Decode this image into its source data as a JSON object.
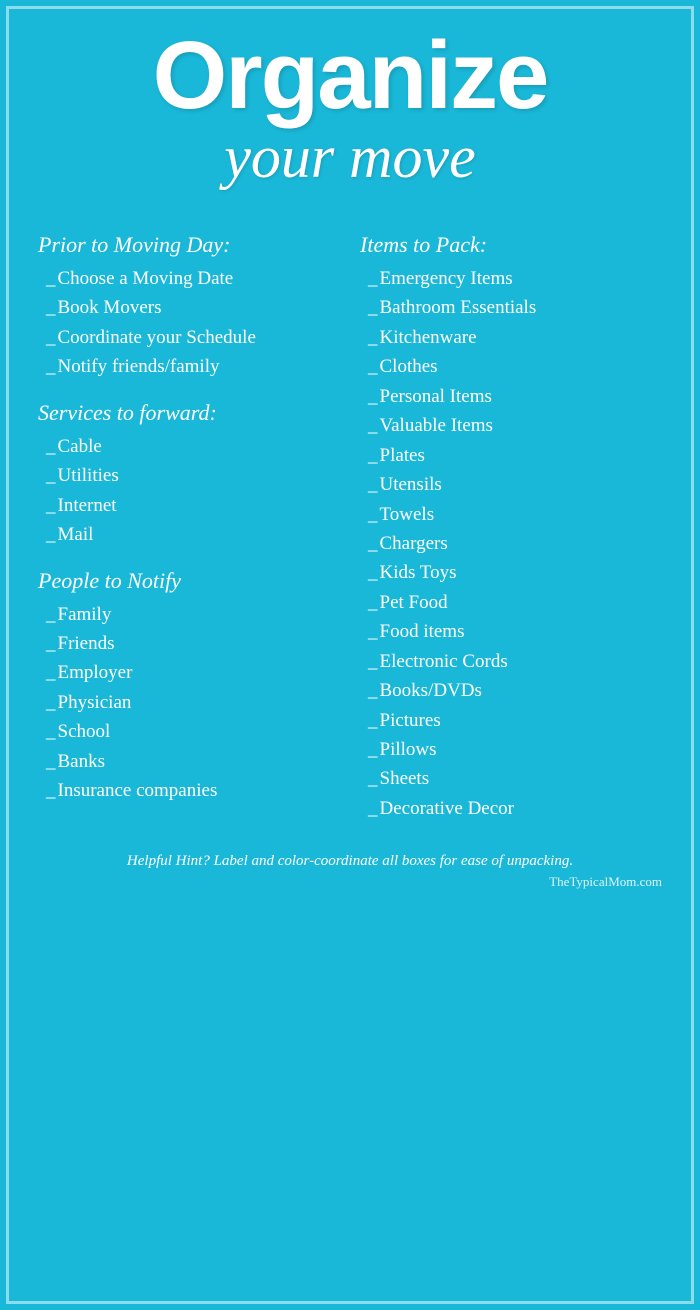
{
  "title": {
    "line1": "Organize",
    "line2": "your move"
  },
  "left": {
    "sections": [
      {
        "heading": "Prior to Moving Day:",
        "items": [
          "Choose a Moving Date",
          "Book Movers",
          "Coordinate your Schedule",
          "Notify friends/family"
        ]
      },
      {
        "heading": "Services to forward:",
        "items": [
          "Cable",
          "Utilities",
          "Internet",
          "Mail"
        ]
      },
      {
        "heading": "People to Notify",
        "items": [
          "Family",
          "Friends",
          "Employer",
          "Physician",
          "School",
          "Banks",
          "Insurance companies"
        ]
      }
    ]
  },
  "right": {
    "heading": "Items to Pack:",
    "items": [
      "Emergency Items",
      "Bathroom Essentials",
      "Kitchenware",
      "Clothes",
      "Personal  Items",
      "Valuable  Items",
      "Plates",
      "Utensils",
      "Towels",
      "Chargers",
      "Kids  Toys",
      "Pet Food",
      "Food items",
      "Electronic Cords",
      "Books/DVDs",
      "Pictures",
      "Pillows",
      "Sheets",
      "Decorative  Decor"
    ]
  },
  "footer": {
    "hint": "Helpful Hint?  Label and color-coordinate all boxes for ease of unpacking.",
    "brand": "TheTypicalMom.com"
  }
}
